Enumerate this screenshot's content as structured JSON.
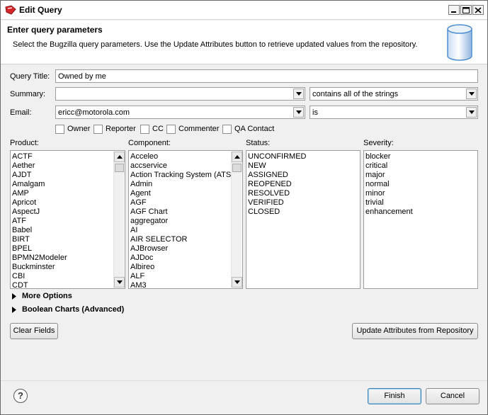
{
  "window": {
    "title": "Edit Query"
  },
  "header": {
    "title": "Enter query parameters",
    "description": "Select the Bugzilla query parameters.  Use the Update Attributes button to retrieve updated values from the repository."
  },
  "form": {
    "query_title_label": "Query Title:",
    "query_title_value": "Owned by me",
    "summary_label": "Summary:",
    "summary_value": "",
    "summary_operator": "contains all of the strings",
    "email_label": "Email:",
    "email_value": "ericc@motorola.com",
    "email_operator": "is",
    "email_roles": [
      {
        "label": "Owner",
        "checked": false
      },
      {
        "label": "Reporter",
        "checked": false
      },
      {
        "label": "CC",
        "checked": false
      },
      {
        "label": "Commenter",
        "checked": false
      },
      {
        "label": "QA Contact",
        "checked": false
      }
    ]
  },
  "lists": {
    "product": {
      "label": "Product:",
      "items": [
        "ACTF",
        "Aether",
        "AJDT",
        "Amalgam",
        "AMP",
        "Apricot",
        "AspectJ",
        "ATF",
        "Babel",
        "BIRT",
        "BPEL",
        "BPMN2Modeler",
        "Buckminster",
        "CBI",
        "CDT"
      ]
    },
    "component": {
      "label": "Component:",
      "items": [
        "Acceleo",
        "accservice",
        "Action Tracking System (ATS)",
        "Admin",
        "Agent",
        "AGF",
        "AGF Chart",
        "aggregator",
        "AI",
        "AIR SELECTOR",
        "AJBrowser",
        "AJDoc",
        "Albireo",
        "ALF",
        "AM3"
      ]
    },
    "status": {
      "label": "Status:",
      "items": [
        "UNCONFIRMED",
        "NEW",
        "ASSIGNED",
        "REOPENED",
        "RESOLVED",
        "VERIFIED",
        "CLOSED"
      ]
    },
    "severity": {
      "label": "Severity:",
      "items": [
        "blocker",
        "critical",
        "major",
        "normal",
        "minor",
        "trivial",
        "enhancement"
      ]
    }
  },
  "sections": {
    "more_options": "More Options",
    "boolean_charts": "Boolean Charts (Advanced)"
  },
  "buttons": {
    "clear_fields": "Clear Fields",
    "update_attributes": "Update Attributes from Repository",
    "finish": "Finish",
    "cancel": "Cancel",
    "help": "?"
  },
  "colors": {
    "window_bg": "#f0f0f0",
    "header_bg": "#ffffff",
    "app_icon": "#d6262b",
    "db_icon": "#4f8fd0"
  },
  "icons": {
    "app": "bugzilla-icon",
    "header": "database-icon",
    "help": "help-icon"
  }
}
